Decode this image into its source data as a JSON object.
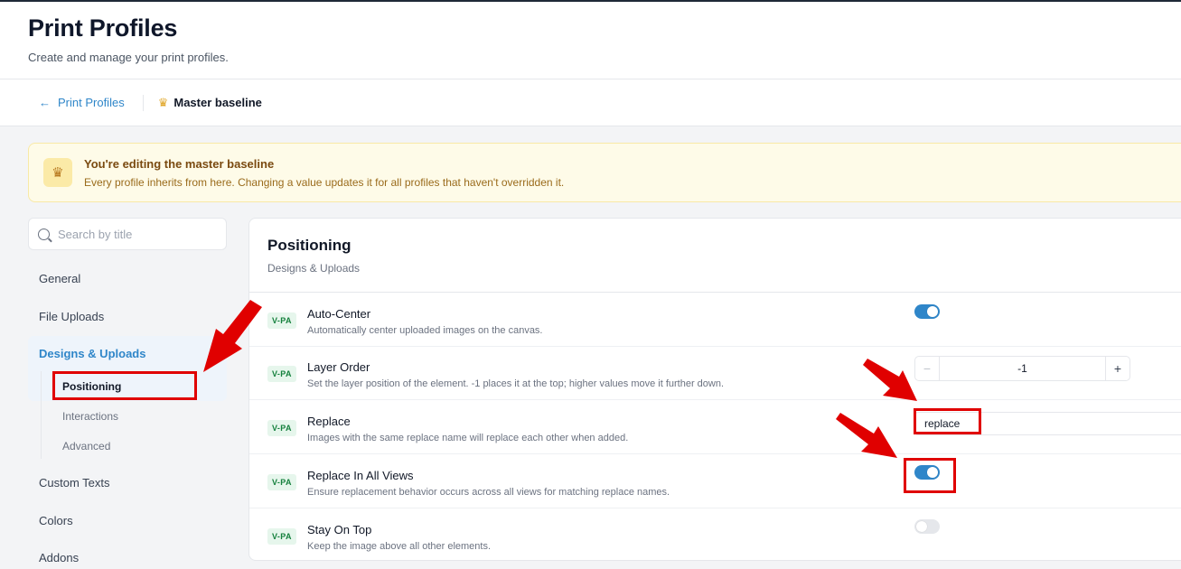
{
  "header": {
    "title": "Print Profiles",
    "subtitle": "Create and manage your print profiles."
  },
  "breadcrumb": {
    "back_label": "Print Profiles",
    "back_icon": "arrow-left-icon",
    "current_label": "Master baseline",
    "current_icon": "crown-icon"
  },
  "banner": {
    "icon": "crown-icon",
    "title": "You're editing the master baseline",
    "description": "Every profile inherits from here. Changing a value updates it for all profiles that haven't overridden it."
  },
  "sidebar": {
    "search_placeholder": "Search by title",
    "items": [
      {
        "label": "General"
      },
      {
        "label": "File Uploads"
      },
      {
        "label": "Designs & Uploads",
        "active": true
      },
      {
        "label": "Custom Texts"
      },
      {
        "label": "Colors"
      },
      {
        "label": "Addons"
      }
    ],
    "subitems": [
      {
        "label": "Positioning",
        "active": true
      },
      {
        "label": "Interactions"
      },
      {
        "label": "Advanced"
      }
    ]
  },
  "panel": {
    "title": "Positioning",
    "subtitle": "Designs & Uploads",
    "settings": [
      {
        "badge": "V-PA",
        "name": "Auto-Center",
        "description": "Automatically center uploaded images on the canvas.",
        "control": "toggle",
        "value": true
      },
      {
        "badge": "V-PA",
        "name": "Layer Order",
        "description": "Set the layer position of the element. -1 places it at the top; higher values move it further down.",
        "control": "stepper",
        "value": "-1",
        "minus": "−",
        "plus": "+"
      },
      {
        "badge": "V-PA",
        "name": "Replace",
        "description": "Images with the same replace name will replace each other when added.",
        "control": "text",
        "value": "replace"
      },
      {
        "badge": "V-PA",
        "name": "Replace In All Views",
        "description": "Ensure replacement behavior occurs across all views for matching replace names.",
        "control": "toggle",
        "value": true
      },
      {
        "badge": "V-PA",
        "name": "Stay On Top",
        "description": "Keep the image above all other elements.",
        "control": "toggle",
        "value": false
      }
    ]
  },
  "colors": {
    "accent": "#2f86c9",
    "annotation_red": "#e00000",
    "badge_green": "#15803d",
    "banner_bg": "#fefbe8"
  }
}
